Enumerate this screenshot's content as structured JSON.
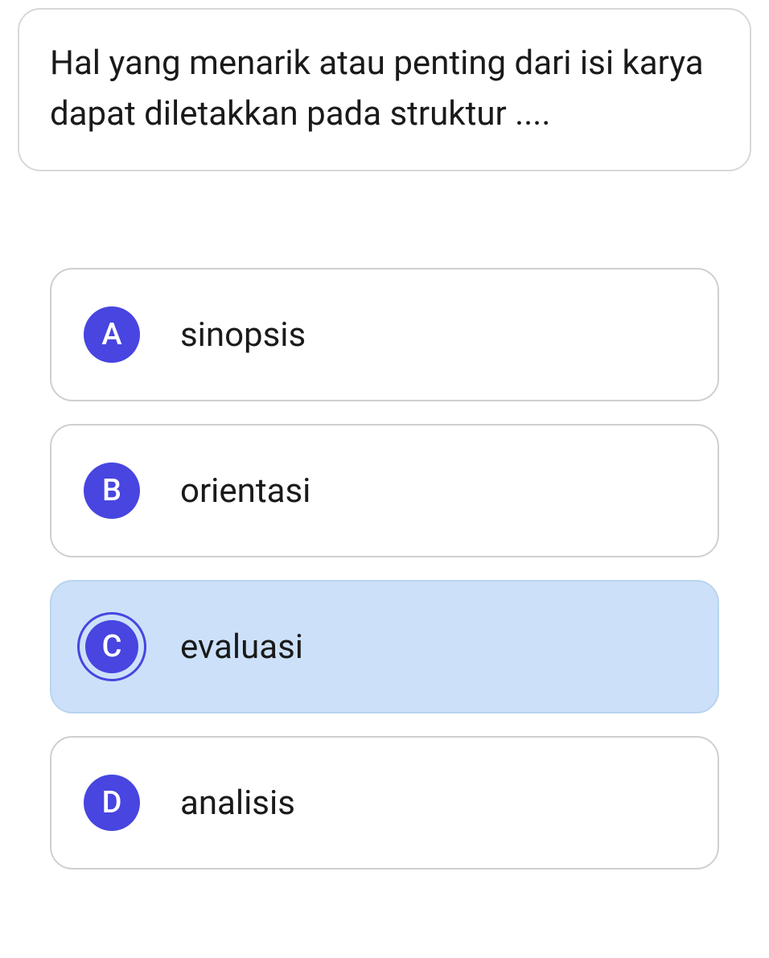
{
  "question": {
    "text": "Hal yang menarik atau penting dari isi karya dapat diletakkan pada struktur ...."
  },
  "options": [
    {
      "letter": "A",
      "label": "sinopsis",
      "selected": false
    },
    {
      "letter": "B",
      "label": "orientasi",
      "selected": false
    },
    {
      "letter": "C",
      "label": "evaluasi",
      "selected": true
    },
    {
      "letter": "D",
      "label": "analisis",
      "selected": false
    }
  ]
}
